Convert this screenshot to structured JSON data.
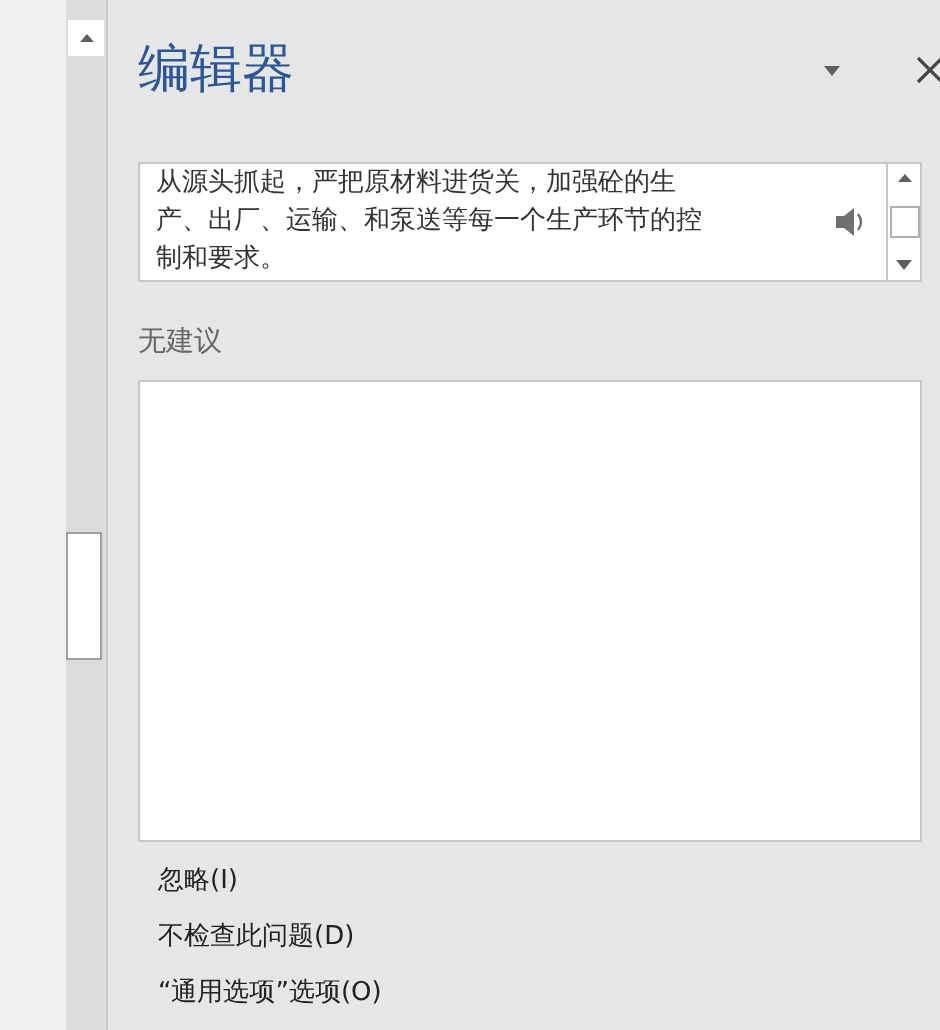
{
  "pane": {
    "title": "编辑器"
  },
  "sentence": {
    "lines": [
      "从源头抓起，严把原材料进货关，加强砼的生",
      "产、出厂、运输、和泵送等每一个生产环节的控",
      "制和要求。"
    ]
  },
  "suggestions": {
    "heading": "无建议"
  },
  "actions": [
    {
      "label": "忽略(I)"
    },
    {
      "label": "不检查此问题(D)"
    },
    {
      "label": "“通用选项”选项(O)"
    }
  ]
}
